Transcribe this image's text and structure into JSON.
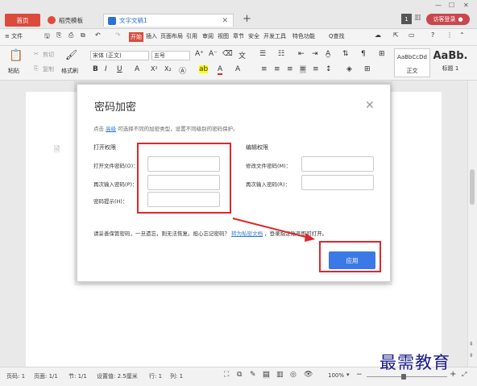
{
  "titlebar": {
    "tab_home": "首页",
    "tab_template": "稻壳模板",
    "tab_doc": "文字文稿1",
    "new_tab": "+",
    "login": "访客登录",
    "badge": "1"
  },
  "menu": {
    "file": "≡ 文件",
    "items": [
      "开始",
      "插入",
      "页面布局",
      "引用",
      "审阅",
      "视图",
      "章节",
      "安全",
      "开发工具",
      "特色功能"
    ],
    "search": "Q查找",
    "help": "?"
  },
  "toolbar": {
    "paste": "粘贴",
    "cut": "剪切",
    "copy": "复制",
    "format_painter": "格式刷",
    "font_name": "宋体 (正文)",
    "font_size": "五号",
    "style1_preview": "AaBbCcDd",
    "style1_label": "正文",
    "style2_preview": "AaBb.",
    "style2_label": "标题 1"
  },
  "dialog": {
    "title": "密码加密",
    "hint_prefix": "点击",
    "hint_link": "高级",
    "hint_suffix": "可选择不同的加密类型，设置不同级别的密码保护。",
    "open_section": "打开权限",
    "edit_section": "编辑权限",
    "open_fields": [
      {
        "label": "打开文件密码(O)：",
        "value": ""
      },
      {
        "label": "再次输入密码(P)：",
        "value": ""
      },
      {
        "label": "密码提示(H)：",
        "value": ""
      }
    ],
    "edit_fields": [
      {
        "label": "修改文件密码(M)：",
        "value": ""
      },
      {
        "label": "再次输入密码(R)：",
        "value": ""
      }
    ],
    "bottom_prefix": "请妥善保管密码，一旦遗忘，则无法恢复。担心忘记密码？",
    "bottom_link": "转为私密文档",
    "bottom_suffix": "，登录指定账号即可打开。",
    "apply": "应用"
  },
  "status": {
    "page": "页码: 1",
    "pages": "页面: 1/1",
    "section": "节: 1/1",
    "setting": "设置值: 2.5厘米",
    "row": "行: 1",
    "col": "列: 1",
    "zoom": "100%"
  },
  "watermark": "最需教育",
  "colors": {
    "accent": "#dc4a3c",
    "apply": "#3b7ae6",
    "highlight": "#e0262a"
  }
}
